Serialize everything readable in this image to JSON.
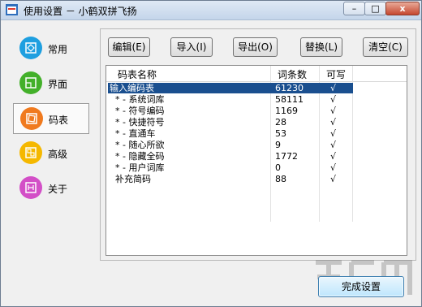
{
  "window": {
    "title": "使用设置 － 小鹤双拼飞扬",
    "controls": {
      "minimize": "–",
      "maximize": "□",
      "close": "x"
    }
  },
  "sidebar": {
    "items": [
      {
        "label": "常用",
        "icon": "diamond-square-icon",
        "color": "#1e9fe0",
        "active": false
      },
      {
        "label": "界面",
        "icon": "layout-square-icon",
        "color": "#43b02a",
        "active": false
      },
      {
        "label": "码表",
        "icon": "rotated-square-icon",
        "color": "#f07a1e",
        "active": true
      },
      {
        "label": "高级",
        "icon": "grid-squares-icon",
        "color": "#f5b800",
        "active": false
      },
      {
        "label": "关于",
        "icon": "h-square-icon",
        "color": "#d34fc7",
        "active": false
      }
    ]
  },
  "toolbar": {
    "edit": "编辑(E)",
    "import": "导入(I)",
    "export": "导出(O)",
    "replace": "替换(L)",
    "clear": "清空(C)"
  },
  "table": {
    "columns": [
      "码表名称",
      "词条数",
      "可写"
    ],
    "rows": [
      {
        "name": "输入编码表",
        "count": "61230",
        "writable": "√",
        "selected": true
      },
      {
        "name": "  * - 系统词库",
        "count": "58111",
        "writable": "√",
        "selected": false
      },
      {
        "name": "  * - 符号编码",
        "count": "1169",
        "writable": "√",
        "selected": false
      },
      {
        "name": "  * - 快捷符号",
        "count": "28",
        "writable": "√",
        "selected": false
      },
      {
        "name": "  * - 直通车",
        "count": "53",
        "writable": "√",
        "selected": false
      },
      {
        "name": "  * - 随心所欲",
        "count": "9",
        "writable": "√",
        "selected": false
      },
      {
        "name": "  * - 隐藏全码",
        "count": "1772",
        "writable": "√",
        "selected": false
      },
      {
        "name": "  * - 用户词库",
        "count": "0",
        "writable": "√",
        "selected": false
      },
      {
        "name": "  补充简码",
        "count": "88",
        "writable": "√",
        "selected": false
      }
    ]
  },
  "footer": {
    "done": "完成设置"
  },
  "colors": {
    "selection": "#1a4f8f",
    "titlebar": "#c4d5ea"
  }
}
